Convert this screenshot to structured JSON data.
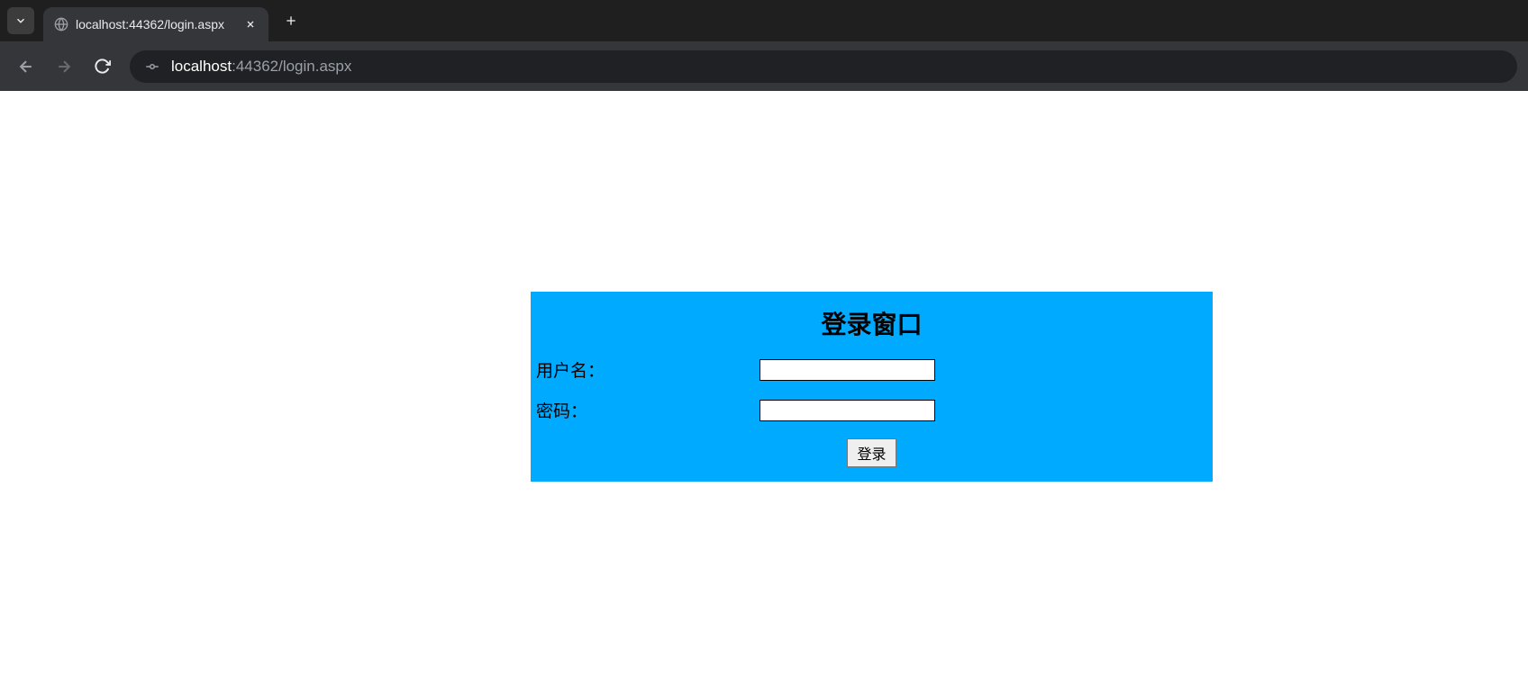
{
  "browser": {
    "tab_title": "localhost:44362/login.aspx",
    "url_host": "localhost",
    "url_port_path": ":44362/login.aspx"
  },
  "login": {
    "title": "登录窗口",
    "username_label": "用户名：",
    "password_label": "密码：",
    "username_value": "",
    "password_value": "",
    "login_button": "登录"
  }
}
